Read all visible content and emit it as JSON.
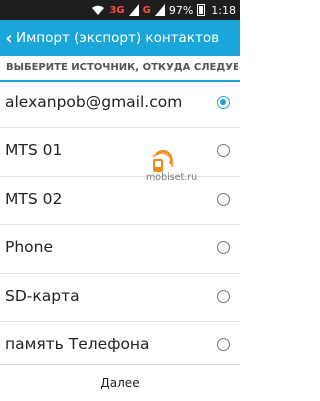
{
  "status_bar": {
    "network1": "3G",
    "network2": "G",
    "battery": "97%",
    "time": "1:18"
  },
  "header": {
    "back_icon": "chevron-left-icon",
    "title": "Импорт (экспорт) контактов"
  },
  "section": {
    "title": "ВЫБЕРИТЕ ИСТОЧНИК, ОТКУДА СЛЕДУЕТ КО..."
  },
  "accounts": [
    {
      "label": "alexanpob@gmail.com",
      "selected": true
    },
    {
      "label": "MTS 01",
      "selected": false
    },
    {
      "label": "MTS 02",
      "selected": false
    },
    {
      "label": "Phone",
      "selected": false
    },
    {
      "label": "SD-карта",
      "selected": false
    },
    {
      "label": "память Телефона",
      "selected": false
    }
  ],
  "footer": {
    "next_label": "Далее"
  },
  "watermark": {
    "text": "mobiset.ru"
  },
  "colors": {
    "accent": "#1aa6d8",
    "status_bg": "#1e1e1e",
    "watermark_orange": "#f28a1b"
  }
}
